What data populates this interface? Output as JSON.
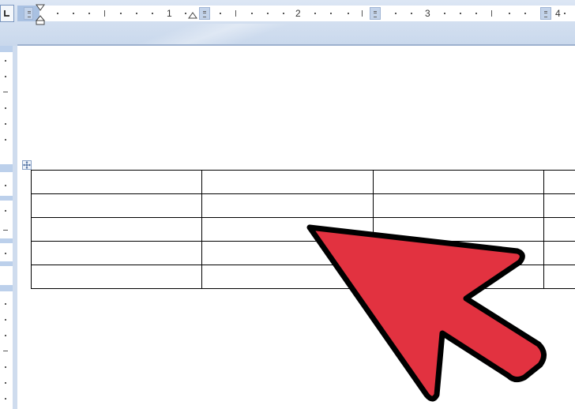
{
  "ruler": {
    "numbers": [
      "1",
      "2",
      "3",
      "4"
    ]
  },
  "icons": {
    "tab_selector": "tab-stop-icon",
    "table_move_handle": "move-icon",
    "pointer": "red-arrow-icon"
  },
  "colors": {
    "arrow_fill": "#e23240",
    "ruler_accent": "#a9c1e2"
  },
  "table": {
    "rows": [
      [
        "",
        "",
        "",
        ""
      ],
      [
        "",
        "",
        "",
        ""
      ],
      [
        "",
        "",
        "",
        ""
      ],
      [
        "",
        "",
        "",
        ""
      ],
      [
        "",
        "",
        "",
        ""
      ]
    ]
  }
}
